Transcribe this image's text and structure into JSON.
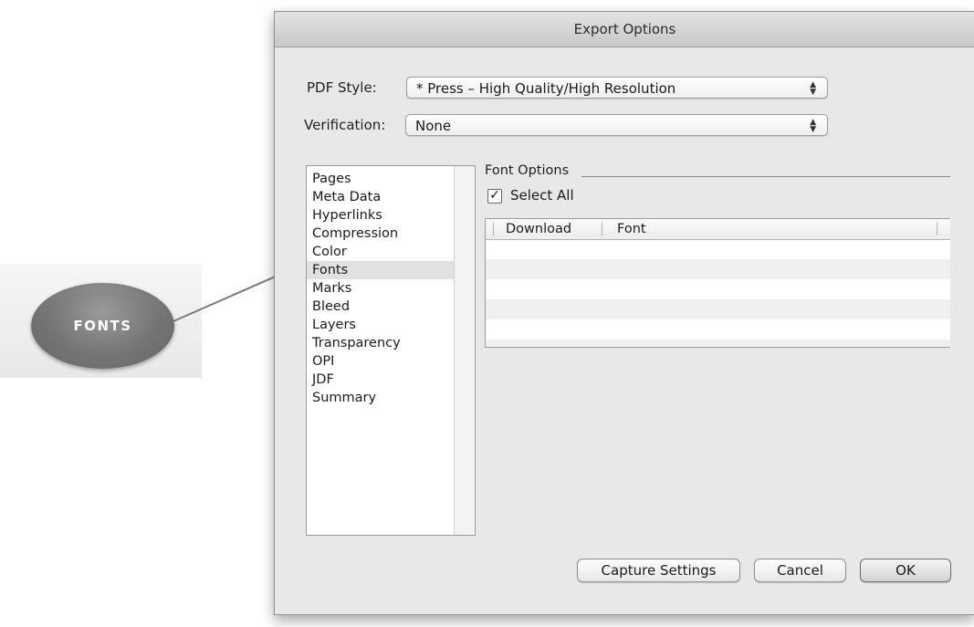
{
  "dialog": {
    "title": "Export Options",
    "pdf_style": {
      "label": "PDF Style:",
      "value": "* Press – High Quality/High Resolution"
    },
    "verification": {
      "label": "Verification:",
      "value": "None"
    },
    "sidebar": {
      "items": [
        {
          "label": "Pages"
        },
        {
          "label": "Meta Data"
        },
        {
          "label": "Hyperlinks"
        },
        {
          "label": "Compression"
        },
        {
          "label": "Color"
        },
        {
          "label": "Fonts",
          "selected": true
        },
        {
          "label": "Marks"
        },
        {
          "label": "Bleed"
        },
        {
          "label": "Layers"
        },
        {
          "label": "Transparency"
        },
        {
          "label": "OPI"
        },
        {
          "label": "JDF"
        },
        {
          "label": "Summary"
        }
      ]
    },
    "font_options": {
      "group_title": "Font Options",
      "select_all_label": "Select All",
      "select_all_checked": true,
      "table": {
        "columns": [
          "Download",
          "Font"
        ],
        "rows": []
      }
    },
    "buttons": {
      "capture": "Capture Settings",
      "cancel": "Cancel",
      "ok": "OK"
    }
  },
  "callout": {
    "label": "FONTS"
  },
  "icons": {
    "checkmark": "✓",
    "popup_arrows": "↕"
  }
}
